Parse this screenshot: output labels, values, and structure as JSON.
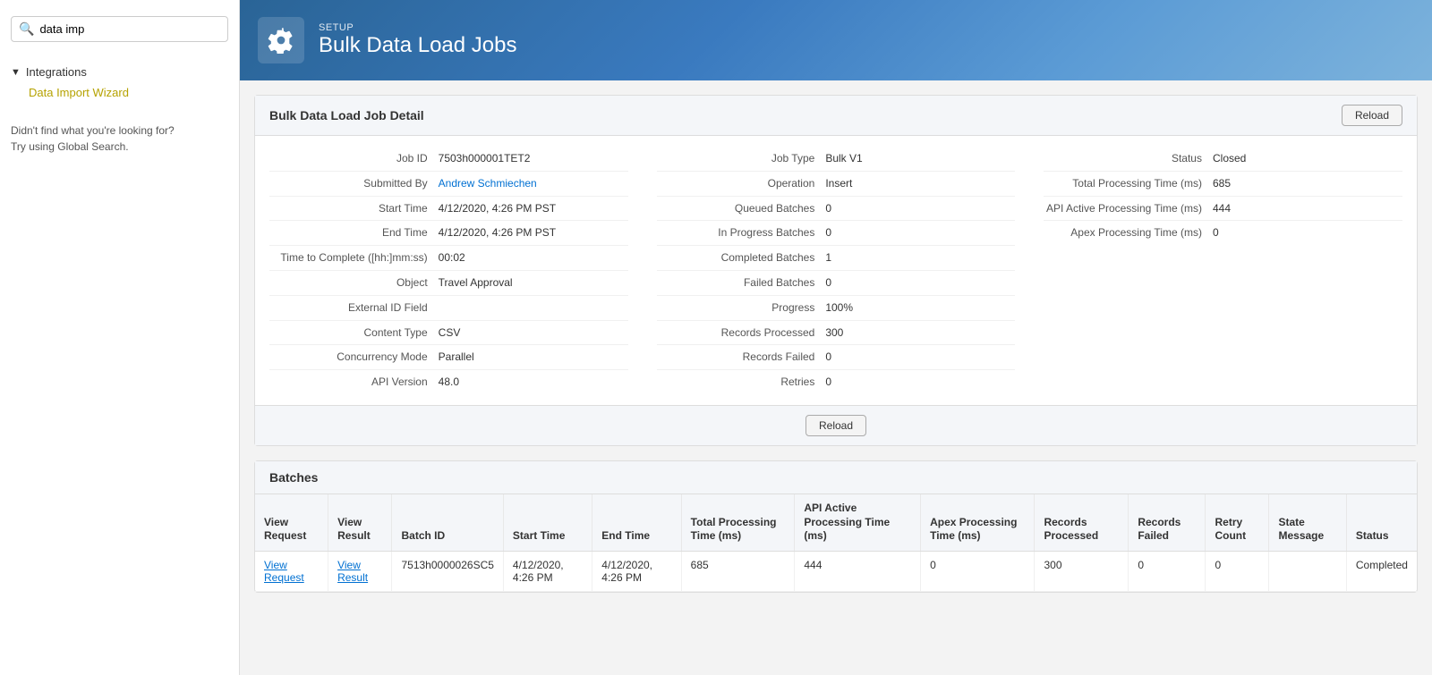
{
  "sidebar": {
    "search_placeholder": "data imp",
    "search_value": "data imp",
    "section_label": "Integrations",
    "link_label": "Data Import Wizard",
    "hint_line1": "Didn't find what you're looking for?",
    "hint_line2": "Try using Global Search."
  },
  "header": {
    "setup_label": "SETUP",
    "title": "Bulk Data Load Jobs",
    "icon_label": "gear-icon"
  },
  "job_detail": {
    "section_title": "Bulk Data Load Job Detail",
    "reload_label": "Reload",
    "fields": {
      "job_id_label": "Job ID",
      "job_id_value": "7503h000001TET2",
      "submitted_by_label": "Submitted By",
      "submitted_by_value": "Andrew Schmiechen",
      "start_time_label": "Start Time",
      "start_time_value": "4/12/2020, 4:26 PM PST",
      "end_time_label": "End Time",
      "end_time_value": "4/12/2020, 4:26 PM PST",
      "time_to_complete_label": "Time to Complete ([hh:]mm:ss)",
      "time_to_complete_value": "00:02",
      "object_label": "Object",
      "object_value": "Travel Approval",
      "external_id_label": "External ID Field",
      "external_id_value": "",
      "content_type_label": "Content Type",
      "content_type_value": "CSV",
      "concurrency_mode_label": "Concurrency Mode",
      "concurrency_mode_value": "Parallel",
      "api_version_label": "API Version",
      "api_version_value": "48.0",
      "job_type_label": "Job Type",
      "job_type_value": "Bulk V1",
      "operation_label": "Operation",
      "operation_value": "Insert",
      "queued_batches_label": "Queued Batches",
      "queued_batches_value": "0",
      "in_progress_batches_label": "In Progress Batches",
      "in_progress_batches_value": "0",
      "completed_batches_label": "Completed Batches",
      "completed_batches_value": "1",
      "failed_batches_label": "Failed Batches",
      "failed_batches_value": "0",
      "progress_label": "Progress",
      "progress_value": "100%",
      "records_processed_label": "Records Processed",
      "records_processed_value": "300",
      "records_failed_label": "Records Failed",
      "records_failed_value": "0",
      "retries_label": "Retries",
      "retries_value": "0",
      "status_label": "Status",
      "status_value": "Closed",
      "total_processing_time_label": "Total Processing Time (ms)",
      "total_processing_time_value": "685",
      "api_active_label": "API Active Processing Time (ms)",
      "api_active_value": "444",
      "apex_label": "Apex Processing Time (ms)",
      "apex_value": "0"
    }
  },
  "batches": {
    "section_title": "Batches",
    "columns": {
      "view_request": "View Request",
      "view_result": "View Result",
      "batch_id": "Batch ID",
      "start_time": "Start Time",
      "end_time": "End Time",
      "total_processing_time": "Total Processing Time (ms)",
      "api_active_processing_time": "API Active Processing Time (ms)",
      "apex_processing_time": "Apex Processing Time (ms)",
      "records_processed": "Records Processed",
      "records_failed": "Records Failed",
      "retry_count": "Retry Count",
      "state_message": "State Message",
      "status": "Status"
    },
    "rows": [
      {
        "view_request": "View Request",
        "view_result": "View Result",
        "batch_id": "7513h0000026SC5",
        "start_time": "4/12/2020, 4:26 PM",
        "end_time": "4/12/2020, 4:26 PM",
        "total_processing_time": "685",
        "api_active_processing_time": "444",
        "apex_processing_time": "0",
        "records_processed": "300",
        "records_failed": "0",
        "retry_count": "0",
        "state_message": "",
        "status": "Completed"
      }
    ]
  }
}
